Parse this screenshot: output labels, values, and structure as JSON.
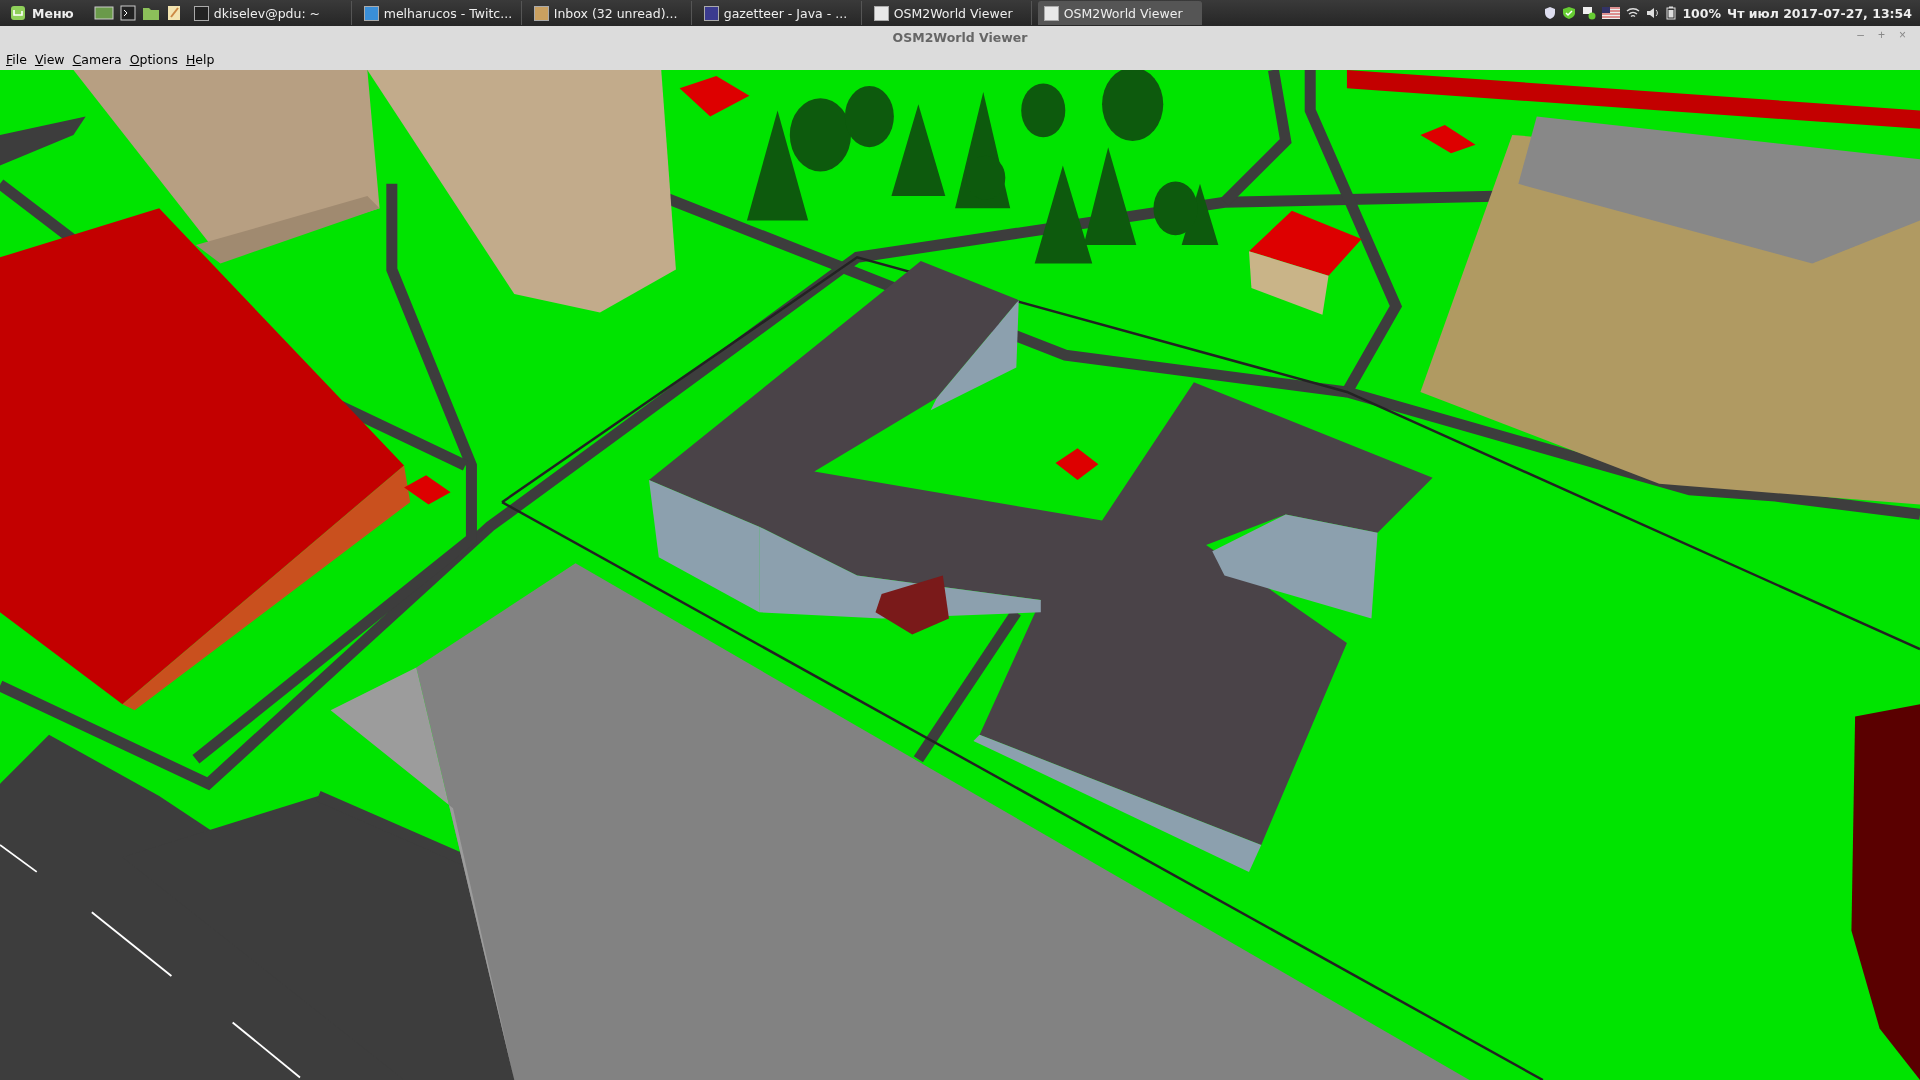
{
  "taskbar": {
    "start_label": "Меню",
    "tasks": [
      {
        "label": "dkiselev@pdu: ~",
        "kind": "terminal",
        "selected": false
      },
      {
        "label": "melharucos - Twitc...",
        "kind": "browser",
        "selected": false
      },
      {
        "label": "Inbox (32 unread)...",
        "kind": "mail",
        "selected": false
      },
      {
        "label": "gazetteer - Java - ...",
        "kind": "ide",
        "selected": false
      },
      {
        "label": "OSM2World Viewer",
        "kind": "java",
        "selected": false
      },
      {
        "label": "OSM2World Viewer",
        "kind": "java",
        "selected": true
      }
    ],
    "battery": "100%",
    "clock": "Чт июл 2017-07-27, 13:54"
  },
  "window": {
    "title": "OSM2World Viewer",
    "controls": [
      "–",
      "+",
      "×"
    ]
  },
  "menu": [
    "File",
    "View",
    "Camera",
    "Options",
    "Help"
  ]
}
